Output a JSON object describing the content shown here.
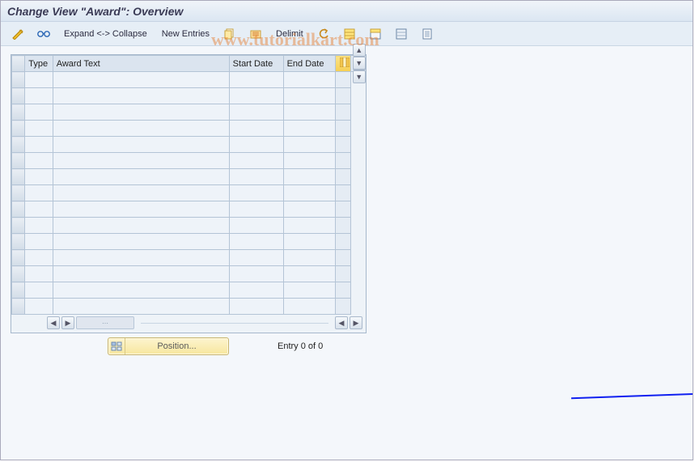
{
  "header": {
    "title": "Change View \"Award\": Overview"
  },
  "toolbar": {
    "expand_collapse": "Expand <-> Collapse",
    "new_entries": "New Entries",
    "delimit": "Delimit"
  },
  "table": {
    "columns": {
      "type": "Type",
      "award_text": "Award Text",
      "start_date": "Start Date",
      "end_date": "End Date"
    },
    "row_count": 15
  },
  "footer": {
    "position_label": "Position...",
    "entry_text": "Entry 0 of 0"
  },
  "watermark": "www.tutorialkart.com"
}
